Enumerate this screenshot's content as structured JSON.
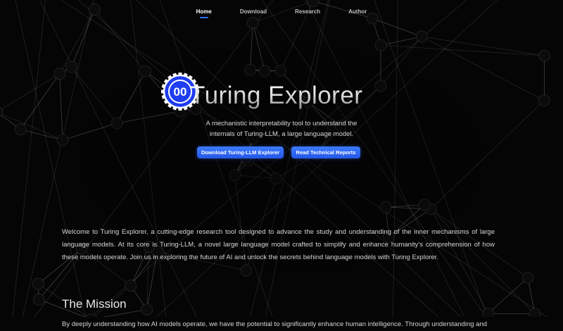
{
  "nav": {
    "items": [
      {
        "label": "Home",
        "active": true
      },
      {
        "label": "Download",
        "active": false
      },
      {
        "label": "Research",
        "active": false
      },
      {
        "label": "Author",
        "active": false
      }
    ]
  },
  "hero": {
    "logo_text": "00",
    "title": "Turing Explorer",
    "subtitle_line1": "A mechanistic interpretability tool to understand the",
    "subtitle_line2": "internals of Turing-LLM, a large language model.",
    "primary_button": "Download Turing-LLM Explorer",
    "secondary_button": "Read Technical Reports"
  },
  "intro": {
    "text": "Welcome to Turing Explorer, a cutting-edge research tool designed to advance the study and understanding of the inner mechanisms of large language models. At its core is Turing-LLM, a novel large language model crafted to simplify and enhance humanity's comprehension of how these models operate. Join us in exploring the future of AI and unlock the secrets behind language models with Turing Explorer."
  },
  "mission": {
    "heading": "The Mission",
    "text": "By deeply understanding how AI models operate, we have the potential to significantly enhance human intelligence. Through understanding and"
  },
  "colors": {
    "background": "#050505",
    "accent": "#2f6bff",
    "logo_blue": "#1f3df0"
  },
  "icons": {
    "logo": "gear-circle-logo-icon"
  }
}
